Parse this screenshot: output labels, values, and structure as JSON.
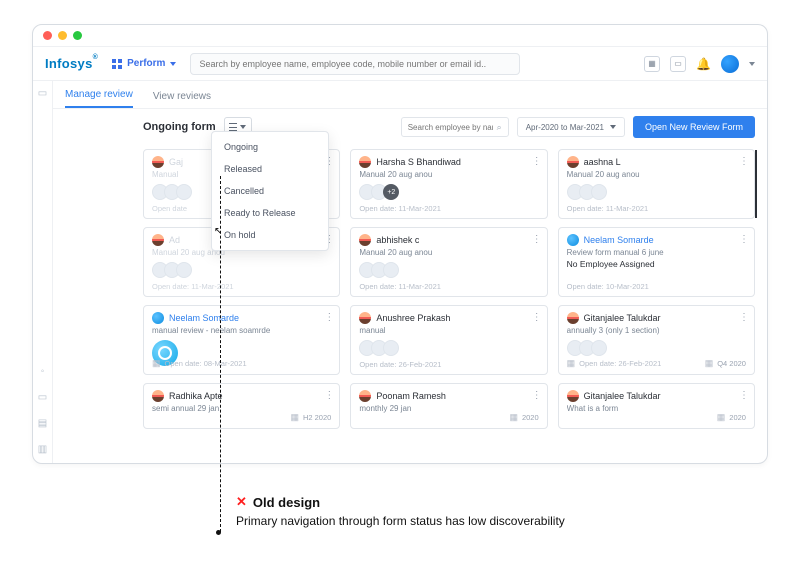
{
  "brand": {
    "name": "Infosys",
    "reg": "®"
  },
  "header": {
    "perform_label": "Perform",
    "search_placeholder": "Search by employee name, employee code, mobile number or email id..",
    "icons": {
      "calendar": "📅",
      "doc": "▭",
      "bell": "🔔"
    }
  },
  "tabs": {
    "manage": "Manage review",
    "view": "View reviews"
  },
  "toolbar": {
    "section_title": "Ongoing form",
    "employee_search_placeholder": "Search employee by name",
    "date_range": "Apr-2020 to Mar-2021",
    "primary_label": "Open New Review Form"
  },
  "status_dropdown": [
    "Ongoing",
    "Released",
    "Cancelled",
    "Ready to Release",
    "On hold"
  ],
  "cards": [
    {
      "name": "Gaj",
      "sub": "Manual",
      "foot": "Open date",
      "dim": true
    },
    {
      "name": "Harsha S Bhandiwad",
      "sub": "Manual 20 aug anou",
      "foot": "Open date: 11-Mar-2021",
      "more": "+2"
    },
    {
      "name": "aashna L",
      "sub": "Manual 20 aug anou",
      "foot": "Open date: 11-Mar-2021",
      "pointer": true
    },
    {
      "name": "Ad",
      "sub": "Manual 20 aug anou",
      "foot": "Open date: 11-Mar-2021",
      "dim": true
    },
    {
      "name": "abhishek c",
      "sub": "Manual 20 aug anou",
      "foot": "Open date: 11-Mar-2021"
    },
    {
      "name": "Neelam Somarde",
      "sub": "Review form manual 6 june",
      "sub2": "No Employee Assigned",
      "foot": "Open date: 10-Mar-2021",
      "avatar": "blue",
      "nameblue": true
    },
    {
      "name": "Neelam Somarde",
      "sub": "manual review - neelam soamrde",
      "foot": "Open date: 08-Mar-2021",
      "big": true,
      "avatar": "blue",
      "nameblue": true,
      "cal": true
    },
    {
      "name": "Anushree Prakash",
      "sub": "manual",
      "foot": "Open date: 26-Feb-2021"
    },
    {
      "name": "Gitanjalee Talukdar",
      "sub": "annually 3 (only 1 section)",
      "foot": "Open date: 26-Feb-2021",
      "right": "Q4 2020",
      "cal": true
    },
    {
      "name": "Radhika Apte",
      "sub": "semi annual 29 jan",
      "right": "H2 2020",
      "short": true,
      "cal": true
    },
    {
      "name": "Poonam Ramesh",
      "sub": "monthly 29 jan",
      "right": "2020",
      "short": true,
      "cal": true
    },
    {
      "name": "Gitanjalee Talukdar",
      "sub": "What is a form",
      "right": "2020",
      "short": true,
      "cal": true
    }
  ],
  "annotation": {
    "title": "Old design",
    "x": "✕",
    "sub": "Primary navigation through form status has low discoverability"
  }
}
